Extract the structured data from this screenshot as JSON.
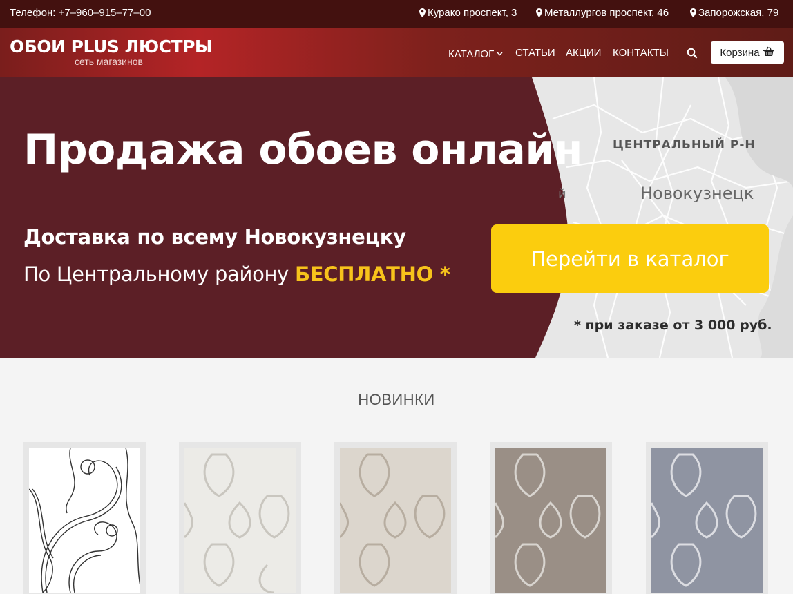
{
  "topbar": {
    "phone": "Телефон: +7–960–915–77–00",
    "addresses": [
      "Курако проспект, 3",
      "Металлургов проспект, 46",
      "Запорожская, 79"
    ]
  },
  "header": {
    "logo_name": "ОБОИ PLUS ЛЮСТРЫ",
    "logo_sub": "сеть магазинов",
    "nav": [
      "КАТАЛОГ",
      "СТАТЬИ",
      "АКЦИИ",
      "КОНТАКТЫ"
    ],
    "cart_label": "Корзина"
  },
  "hero": {
    "title": "Продажа обоев онлайн",
    "sub1": "Доставка по всему Новокузнецку",
    "sub2_prefix": "По Центральному району ",
    "sub2_free": "БЕСПЛАТНО *",
    "cta": "Перейти в каталог",
    "note": "* при заказе от 3 000 руб.",
    "map_district": "ЦЕНТРАЛЬНЫЙ Р-Н",
    "map_city": "Новокузнецк",
    "map_fragment": "й"
  },
  "section": {
    "title": "НОВИНКИ"
  },
  "products": [
    {
      "pattern": "swirl",
      "color": "#ffffff"
    },
    {
      "pattern": "damask",
      "color": "#ecebe7"
    },
    {
      "pattern": "damask",
      "color": "#dcd6cd"
    },
    {
      "pattern": "damask",
      "color": "#9a8f86"
    },
    {
      "pattern": "damask",
      "color": "#8f94a2"
    }
  ],
  "colors": {
    "topbar": "#43110f",
    "hero_bg": "#5c1f26",
    "accent_yellow": "#fbcd0e",
    "free_text": "#f7c31b"
  }
}
